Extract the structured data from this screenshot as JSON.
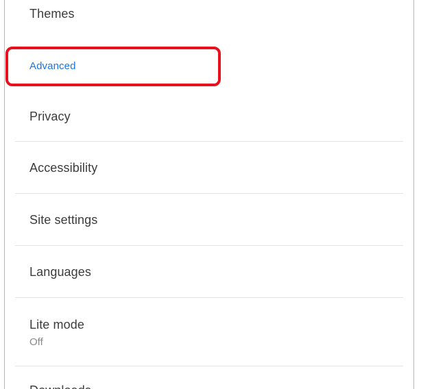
{
  "settings": {
    "items": [
      {
        "label": "Themes"
      },
      {
        "label": "Advanced"
      },
      {
        "label": "Privacy"
      },
      {
        "label": "Accessibility"
      },
      {
        "label": "Site settings"
      },
      {
        "label": "Languages"
      },
      {
        "label": "Lite mode",
        "sublabel": "Off"
      },
      {
        "label": "Downloads"
      }
    ]
  },
  "colors": {
    "accent": "#1a73e8",
    "highlight": "#e8101d"
  }
}
